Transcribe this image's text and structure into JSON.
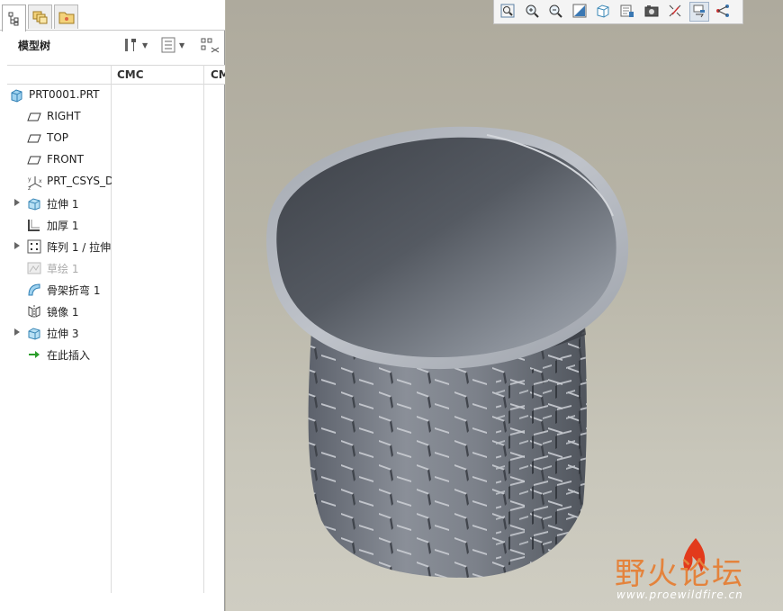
{
  "panel": {
    "title": "模型树",
    "columns": [
      "CMC",
      "CM"
    ]
  },
  "tree": [
    {
      "label": "PRT0001.PRT",
      "icon": "part-icon",
      "expandable": false,
      "dim": false
    },
    {
      "label": "RIGHT",
      "icon": "datum-plane-icon",
      "expandable": false,
      "dim": false
    },
    {
      "label": "TOP",
      "icon": "datum-plane-icon",
      "expandable": false,
      "dim": false
    },
    {
      "label": "FRONT",
      "icon": "datum-plane-icon",
      "expandable": false,
      "dim": false
    },
    {
      "label": "PRT_CSYS_D",
      "icon": "csys-icon",
      "expandable": false,
      "dim": false
    },
    {
      "label": "拉伸 1",
      "icon": "extrude-icon",
      "expandable": true,
      "dim": false
    },
    {
      "label": "加厚 1",
      "icon": "thicken-icon",
      "expandable": false,
      "dim": false
    },
    {
      "label": "阵列 1 / 拉伸",
      "icon": "pattern-icon",
      "expandable": true,
      "dim": false
    },
    {
      "label": "草绘 1",
      "icon": "sketch-icon",
      "expandable": false,
      "dim": true
    },
    {
      "label": "骨架折弯 1",
      "icon": "spinal-bend-icon",
      "expandable": false,
      "dim": false
    },
    {
      "label": "镜像 1",
      "icon": "mirror-icon",
      "expandable": false,
      "dim": false
    },
    {
      "label": "拉伸 3",
      "icon": "extrude-icon",
      "expandable": true,
      "dim": false
    },
    {
      "label": "在此插入",
      "icon": "insert-here-icon",
      "expandable": false,
      "dim": false
    }
  ],
  "view_toolbar": [
    "zoom-fit-icon",
    "zoom-in-icon",
    "zoom-out-icon",
    "repaint-icon",
    "display-style-icon",
    "saved-views-icon",
    "view-manager-icon",
    "datum-display-icon",
    "annotation-display-icon",
    "spin-center-icon"
  ],
  "watermark": {
    "title": "野火论坛",
    "url": "www.proewildfire.cn"
  }
}
